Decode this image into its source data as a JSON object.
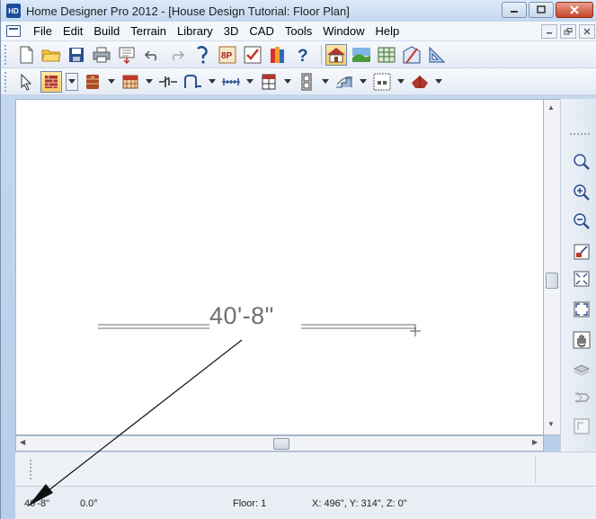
{
  "window": {
    "title": "Home Designer Pro 2012 - [House Design Tutorial: Floor Plan]",
    "app_icon_text": "HD",
    "minimize_icon": "minimize-icon",
    "maximize_icon": "maximize-icon",
    "close_icon": "close-icon"
  },
  "menubar": {
    "items": [
      "File",
      "Edit",
      "Build",
      "Terrain",
      "Library",
      "3D",
      "CAD",
      "Tools",
      "Window",
      "Help"
    ]
  },
  "toolbar1": {
    "icons": [
      "new-file-icon",
      "open-folder-icon",
      "save-icon",
      "print-icon",
      "print-preview-icon",
      "undo-icon",
      "redo-icon",
      "help-pointer-icon",
      "plan-materials-icon",
      "checklist-icon",
      "library-books-icon",
      "help-icon",
      "floor-plan-view-icon",
      "terrain-view-icon",
      "cross-section-icon",
      "elevation-view-icon",
      "perspective-view-icon"
    ]
  },
  "toolbar2": {
    "icons": [
      "select-arrow-icon",
      "wall-tool-icon",
      "cabinet-tool-icon",
      "floor-hatch-icon",
      "electrical-icon",
      "door-tool-icon",
      "dimension-tool-icon",
      "window-tool-icon",
      "cabinet-column-icon",
      "stairs-tool-icon",
      "room-tool-icon",
      "roof-tool-icon"
    ]
  },
  "right_toolbar": {
    "icons": [
      "zoom-icon",
      "zoom-in-icon",
      "zoom-out-icon",
      "undo-zoom-icon",
      "fill-window-icon",
      "fill-window-building-icon",
      "pan-hand-icon",
      "layer-icon",
      "reference-icon",
      "page-icon"
    ]
  },
  "drawing": {
    "dimension_text": "40'-8\""
  },
  "statusbar": {
    "length": "40'-8\"",
    "angle": "0.0°",
    "floor": "Floor: 1",
    "coords": "X: 496\", Y: 314\", Z: 0\""
  },
  "colors": {
    "window_frame": "#b7cde9",
    "close_button": "#c7452a",
    "active_tool": "#f7c85d",
    "dimension_line": "#8a8a8a"
  }
}
